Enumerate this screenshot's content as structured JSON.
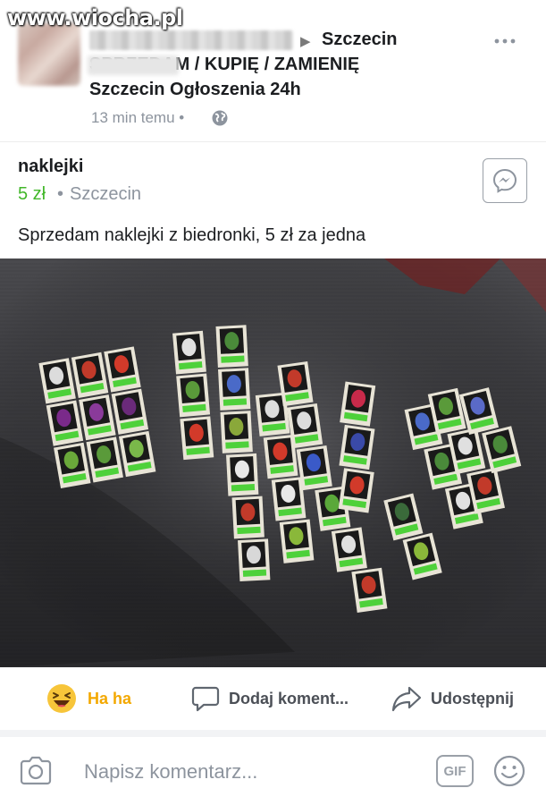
{
  "watermark": "www.wiocha.pl",
  "post": {
    "author_city": "Szczecin",
    "group_name_line1": "SPRZEDAM / KUPIĘ / ZAMIENIĘ",
    "group_name_line2": "Szczecin Ogłoszenia 24h",
    "timestamp": "13 min temu •",
    "more_icon": "more-horizontal-icon",
    "privacy_icon": "globe-icon"
  },
  "listing": {
    "title": "naklejki",
    "price": "5 zł",
    "separator": "•",
    "location": "Szczecin",
    "message_icon": "messenger-icon"
  },
  "post_text": "Sprzedam naklejki z biedronki, 5 zł za jedna",
  "actions": {
    "haha_label": "Ha ha",
    "comment_label": "Dodaj koment...",
    "share_label": "Udostępnij"
  },
  "composer": {
    "placeholder": "Napisz komentarz...",
    "gif_label": "GIF"
  },
  "colors": {
    "price_green": "#42b72a",
    "haha_yellow": "#f3a800",
    "muted_gray": "#8d949e"
  }
}
